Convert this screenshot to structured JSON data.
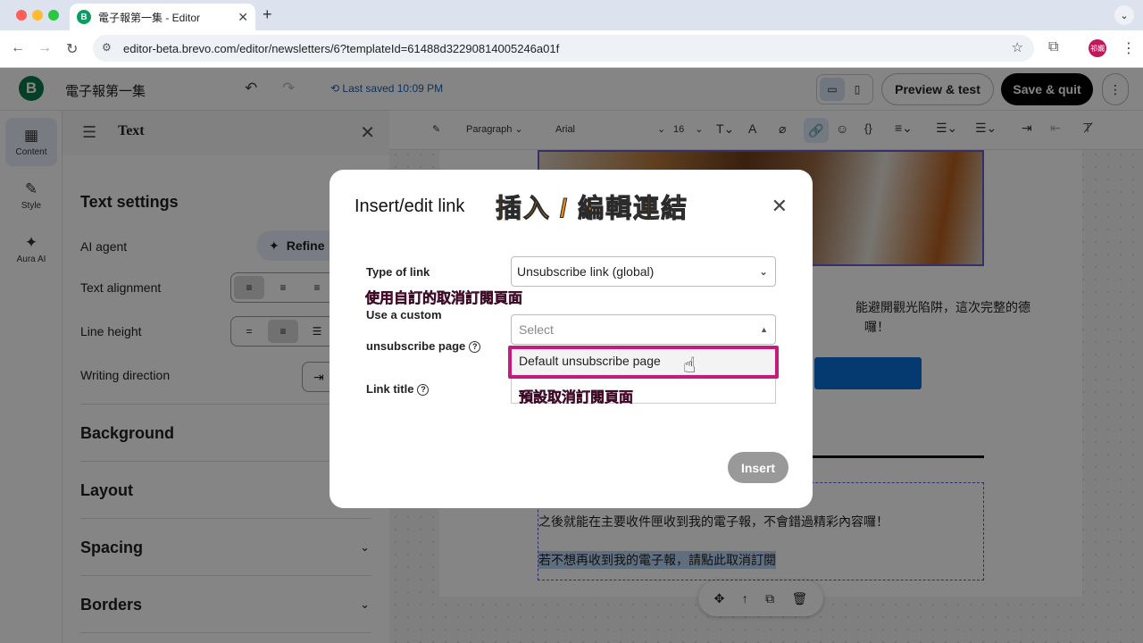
{
  "browser": {
    "tab_title": "電子報第一集 - Editor",
    "tab_favicon_letter": "B",
    "new_tab": "+",
    "url": "editor-beta.brevo.com/editor/newsletters/6?templateId=61488d32290814005246a01f",
    "profile_initials": "祁嫻"
  },
  "header": {
    "logo_letter": "B",
    "doc_title": "電子報第一集",
    "last_saved": "Last saved 10:09 PM",
    "preview_label": "Preview & test",
    "save_quit_label": "Save & quit"
  },
  "rail": {
    "items": [
      {
        "label": "Content",
        "icon": "grid-icon"
      },
      {
        "label": "Style",
        "icon": "brush-icon"
      },
      {
        "label": "Aura AI",
        "icon": "magic-wand-icon"
      }
    ]
  },
  "panel": {
    "title": "Text",
    "section_title": "Text settings",
    "ai_agent_label": "AI agent",
    "refine_label": "Refine",
    "text_alignment_label": "Text alignment",
    "line_height_label": "Line height",
    "writing_direction_label": "Writing direction",
    "sections": [
      "Background",
      "Layout",
      "Spacing",
      "Borders"
    ]
  },
  "toolbar": {
    "block_type": "Paragraph",
    "font_family": "Arial",
    "font_size": "16"
  },
  "email": {
    "line1": "能避開觀光陷阱，這次完整的德",
    "line2": "囉！",
    "line3": "之後就能在主要收件匣收到我的電子報，不會錯過精彩內容囉！",
    "line4": "若不想再收到我的電子報，請點此取消訂閱"
  },
  "modal": {
    "title": "Insert/edit link",
    "annotation_title": "插入 / 編輯連結",
    "type_label": "Type of link",
    "type_value": "Unsubscribe link (global)",
    "annotation_custom": "使用自訂的取消訂閱頁面",
    "custom_label_line1": "Use a custom",
    "custom_label_line2": "unsubscribe page",
    "select_placeholder": "Select",
    "option_default": "Default unsubscribe page",
    "annotation_default": "預設取消訂閱頁面",
    "link_title_label": "Link title",
    "insert_label": "Insert"
  },
  "colors": {
    "brand_green": "#0b7a4b",
    "accent_blue": "#0b6fd6",
    "annotation_orange": "#e8891a",
    "annotation_pink": "#e6158a",
    "highlight_box": "#c51b7d"
  }
}
